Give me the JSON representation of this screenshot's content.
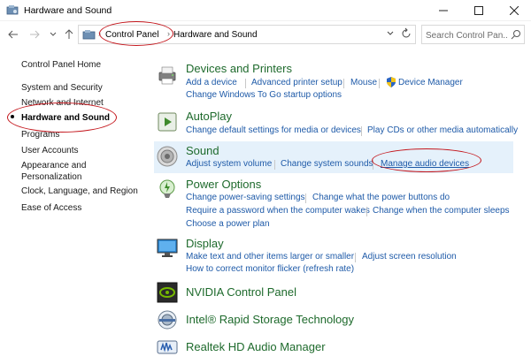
{
  "window": {
    "title": "Hardware and Sound"
  },
  "address": {
    "crumbs": [
      "Control Panel",
      "Hardware and Sound"
    ],
    "search_placeholder": "Search Control Pan..."
  },
  "leftnav": {
    "items": [
      "Control Panel Home",
      "System and Security",
      "Network and Internet",
      "Hardware and Sound",
      "Programs",
      "User Accounts",
      "Appearance and Personalization",
      "Clock, Language, and Region",
      "Ease of Access"
    ],
    "active_index": 3
  },
  "sections": {
    "devices": {
      "title": "Devices and Printers",
      "links": [
        "Add a device",
        "Advanced printer setup",
        "Mouse",
        "Device Manager",
        "Change Windows To Go startup options"
      ]
    },
    "autoplay": {
      "title": "AutoPlay",
      "links": [
        "Change default settings for media or devices",
        "Play CDs or other media automatically"
      ]
    },
    "sound": {
      "title": "Sound",
      "links": [
        "Adjust system volume",
        "Change system sounds",
        "Manage audio devices"
      ]
    },
    "power": {
      "title": "Power Options",
      "links": [
        "Change power-saving settings",
        "Change what the power buttons do",
        "Require a password when the computer wakes",
        "Change when the computer sleeps",
        "Choose a power plan"
      ]
    },
    "display": {
      "title": "Display",
      "links": [
        "Make text and other items larger or smaller",
        "Adjust screen resolution",
        "How to correct monitor flicker (refresh rate)"
      ]
    },
    "nvidia": {
      "title": "NVIDIA Control Panel"
    },
    "intel": {
      "title": "Intel® Rapid Storage Technology"
    },
    "realtek": {
      "title": "Realtek HD Audio Manager"
    }
  },
  "colors": {
    "link": "#1e5aa8",
    "section_title": "#1e6a2c",
    "highlight": "#e5f1fb",
    "annotation": "#c4161c"
  }
}
